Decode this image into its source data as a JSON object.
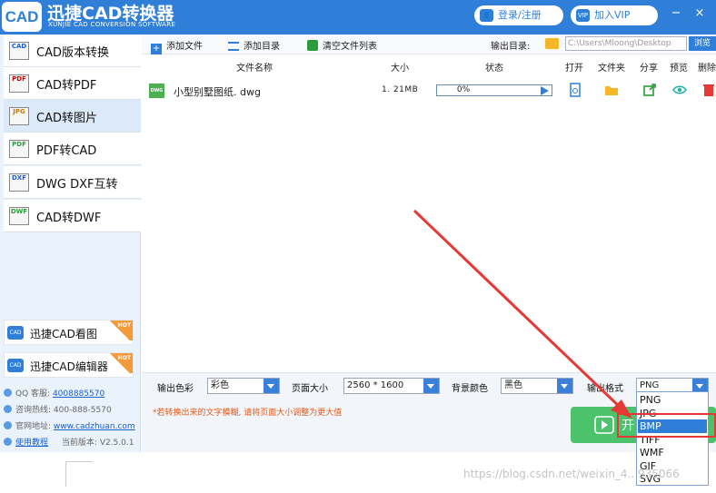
{
  "app": {
    "logo_text": "CAD",
    "title": "迅捷CAD转换器",
    "subtitle": "XUNJIE CAD CONVERSION SOFTWARE",
    "login_label": "登录/注册",
    "vip_label": "加入VIP",
    "vip_icon_text": "VIP",
    "minimize": "−",
    "close": "×"
  },
  "sidebar": {
    "items": [
      {
        "label": "CAD版本转换",
        "icon": "cad-version-icon",
        "icon_text": "CAD"
      },
      {
        "label": "CAD转PDF",
        "icon": "cad-to-pdf-icon",
        "icon_text": "PDF"
      },
      {
        "label": "CAD转图片",
        "icon": "cad-to-image-icon",
        "icon_text": "JPG"
      },
      {
        "label": "PDF转CAD",
        "icon": "pdf-to-cad-icon",
        "icon_text": "PDF"
      },
      {
        "label": "DWG DXF互转",
        "icon": "dwg-dxf-icon",
        "icon_text": "DXF"
      },
      {
        "label": "CAD转DWF",
        "icon": "cad-to-dwf-icon",
        "icon_text": "DWF"
      }
    ],
    "promos": [
      {
        "label": "迅捷CAD看图",
        "badge": "HOT",
        "icon_text": "CAD"
      },
      {
        "label": "迅捷CAD编辑器",
        "badge": "HOT",
        "icon_text": "CAD"
      }
    ],
    "info": {
      "qq_label": "QQ 客服:",
      "qq_value": "4008885570",
      "phone_label": "咨询热线:",
      "phone_value": "400-888-5570",
      "site_label": "官网地址:",
      "site_value": "www.cadzhuan.com",
      "tutorial": "使用教程",
      "version_label": "当前版本:",
      "version_value": "V2.5.0.1"
    }
  },
  "toolbar": {
    "add_file": "添加文件",
    "add_dir": "添加目录",
    "clear_list": "清空文件列表",
    "output_dir_label": "输出目录:",
    "output_dir_value": "C:\\Users\\Mloong\\Desktop",
    "browse": "浏览"
  },
  "table": {
    "headers": [
      "文件名称",
      "大小",
      "状态",
      "打开",
      "文件夹",
      "分享",
      "预览",
      "删除"
    ],
    "rows": [
      {
        "icon_text": "DWG",
        "name": "小型别墅图纸. dwg",
        "size": "1. 21MB",
        "progress_text": "0%",
        "progress": 0
      }
    ]
  },
  "bottom": {
    "color_label": "输出色彩",
    "color_value": "彩色",
    "page_size_label": "页面大小",
    "page_size_value": "2560 * 1600",
    "bg_label": "背景颜色",
    "bg_value": "黑色",
    "format_label": "输出格式",
    "format_value": "PNG",
    "hint": "*若转换出来的文字模糊, 请将页面大小调整为更大值",
    "convert_label": "开"
  },
  "format_options": [
    "PNG",
    "JPG",
    "BMP",
    "TIFF",
    "WMF",
    "GIF",
    "SVG"
  ],
  "format_highlighted": "BMP",
  "watermark": "https://blog.csdn.net/weixin_4...935066",
  "colors": {
    "brand": "#2f7fd8",
    "highlight": "#e53935",
    "convert": "#4cc26c"
  }
}
